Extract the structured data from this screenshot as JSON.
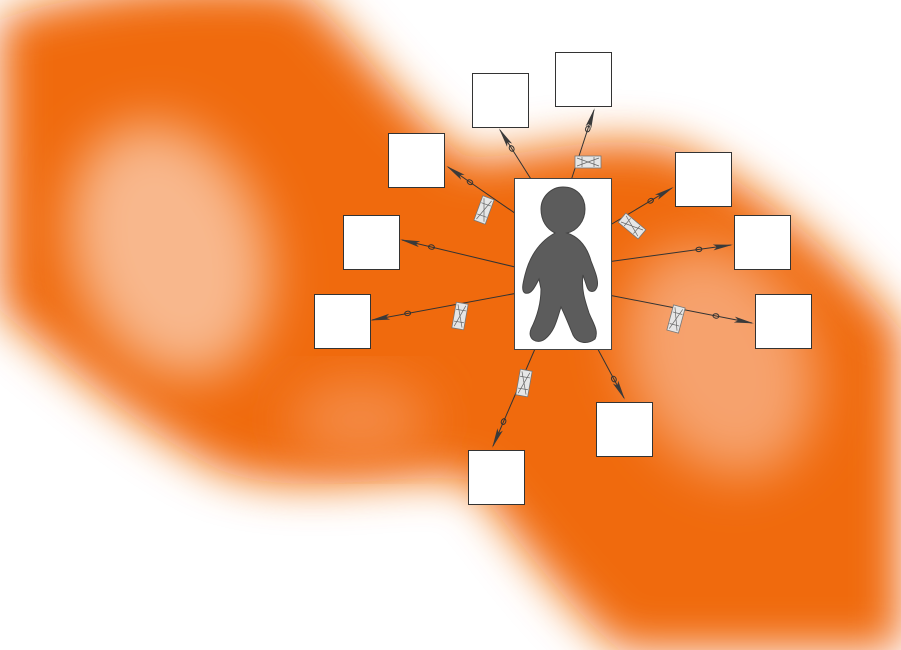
{
  "colors": {
    "background_band": "#f06a0e",
    "band_highlight": "#f8b78c",
    "figure": "#5c5c5c",
    "arrow": "#333333",
    "box_border": "#333333"
  },
  "figure": {
    "icon": "person-silhouette-icon"
  },
  "labels": [
    {
      "id": "label-box-1",
      "text": ""
    },
    {
      "id": "label-box-2",
      "text": ""
    },
    {
      "id": "label-box-3",
      "text": ""
    },
    {
      "id": "label-box-4",
      "text": ""
    },
    {
      "id": "label-box-5",
      "text": ""
    },
    {
      "id": "label-box-6",
      "text": ""
    },
    {
      "id": "label-box-7",
      "text": ""
    },
    {
      "id": "label-box-8",
      "text": ""
    },
    {
      "id": "label-box-9",
      "text": ""
    },
    {
      "id": "label-box-10",
      "text": ""
    }
  ]
}
